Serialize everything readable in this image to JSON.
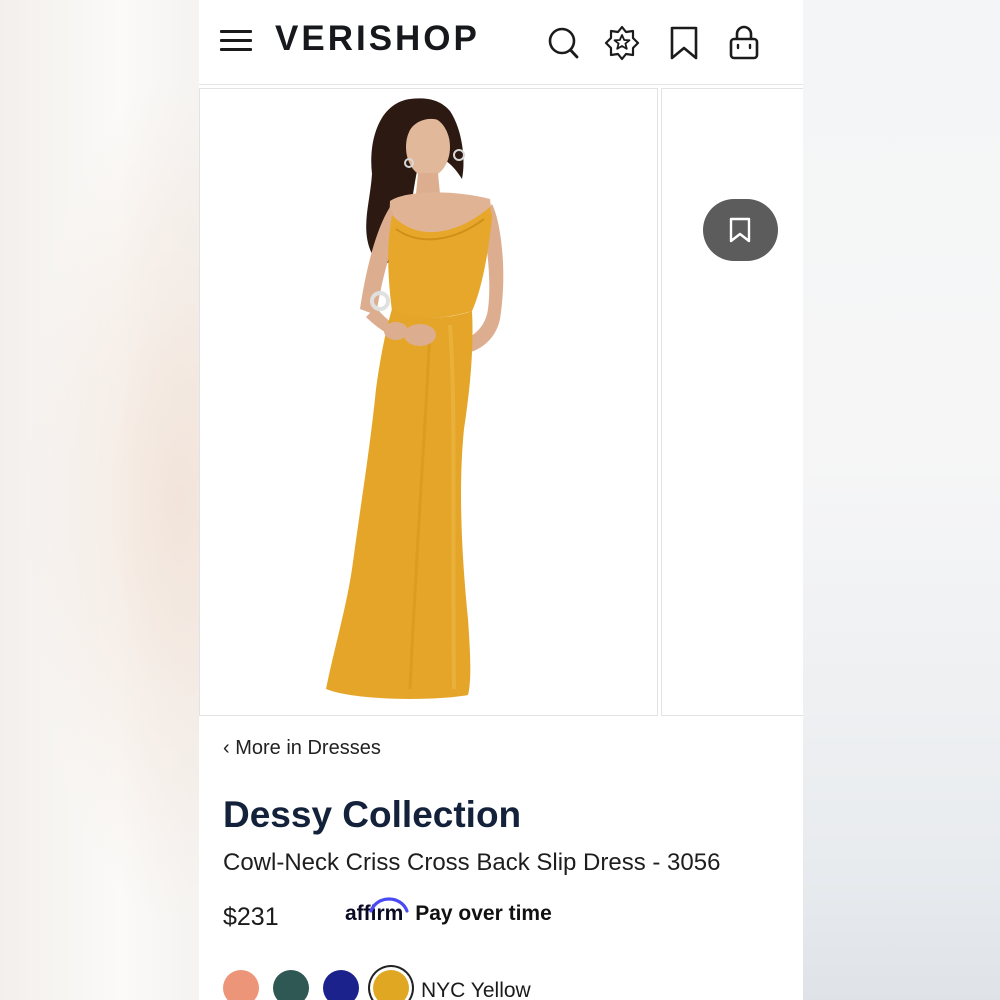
{
  "header": {
    "logo": "VERISHOP",
    "icons": [
      "menu-icon",
      "search-icon",
      "rewards-star-icon",
      "bookmark-icon",
      "shopping-bag-icon"
    ]
  },
  "gallery": {
    "main_image": "model in yellow cowl-neck satin slip dress",
    "save_button_icon": "bookmark-icon"
  },
  "product": {
    "back_link": "‹ More in Dresses",
    "brand": "Dessy Collection",
    "name": "Cowl-Neck Criss Cross Back Slip Dress - 3056",
    "price": "$231",
    "affirm_logo": "affirm",
    "affirm_text": "Pay over time",
    "selected_color": "NYC Yellow",
    "swatches": [
      {
        "color": "#ec9579"
      },
      {
        "color": "#2f5754"
      },
      {
        "color": "#1c228c"
      },
      {
        "color": "#e0a722",
        "selected": true
      }
    ]
  },
  "colors": {
    "brand_navy": "#13213a",
    "dress_yellow": "#e5a528",
    "affirm_blue": "#4a4af4"
  }
}
